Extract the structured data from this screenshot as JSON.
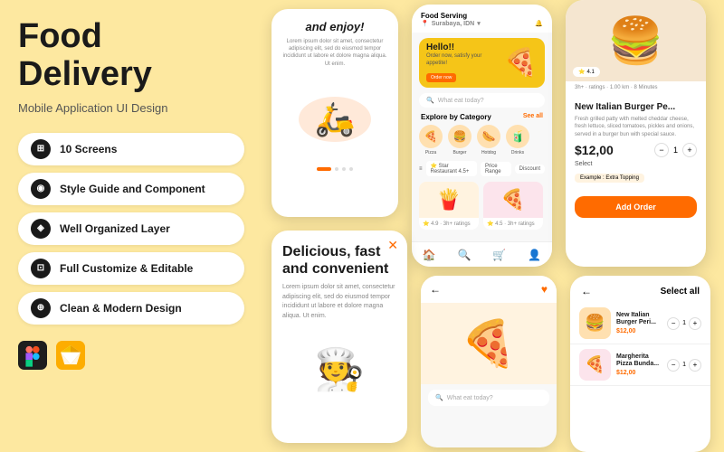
{
  "left": {
    "title": "Food Delivery",
    "subtitle": "Mobile Application UI Design",
    "features": [
      {
        "icon": "⊞",
        "label": "10 Screens"
      },
      {
        "icon": "◉",
        "label": "Style Guide and Component"
      },
      {
        "icon": "◈",
        "label": "Well Organized Layer"
      },
      {
        "icon": "⊡",
        "label": "Full Customize & Editable"
      },
      {
        "icon": "⊕",
        "label": "Clean & Modern Design"
      }
    ]
  },
  "phone1": {
    "headline": "and enjoy!",
    "body": "Lorem ipsum dolor sit amet, consectetur adipiscing elit, sed do eiusmod tempor incididunt ut labore et dolore magna aliqua. Ut enim."
  },
  "phone2": {
    "app_title": "Food Serving",
    "location": "Surabaya, IDN",
    "banner_hello": "Hello!!",
    "banner_sub": "Order now, satisfy your appetite!",
    "banner_btn": "Order now",
    "search_placeholder": "What eat today?",
    "category_title": "Explore by Category",
    "see_all": "See all",
    "categories": [
      {
        "emoji": "🍕",
        "label": "Pizza"
      },
      {
        "emoji": "🍔",
        "label": "Burger"
      },
      {
        "emoji": "🌭",
        "label": "Hotdog"
      },
      {
        "emoji": "🧃",
        "label": "Drinks"
      }
    ],
    "filters": [
      "⭐ Star Restaurant 4.5+",
      "Price Range",
      "Discount"
    ]
  },
  "phone3": {
    "rating": "4.1",
    "rating_count": "3h+ · ratings · 1.00 km · 8 Minutes",
    "name": "New Italian Burger Pe...",
    "desc": "Fresh grilled patty with melted cheddar cheese, fresh lettuce, sliced tomatoes, pickles and onions, served in a burger bun with special sauce.",
    "price": "$12,00",
    "qty": "1",
    "label": "Select",
    "extra_label": "Example : Extra Topping",
    "add_btn": "Add Order"
  },
  "phone4": {
    "headline": "Delicious, fast and convenient",
    "body": "Lorem ipsum dolor sit amet, consectetur adipiscing elit, sed do eiusmod tempor incididunt ut labore et dolore magna aliqua. Ut enim."
  },
  "phone5": {
    "search_placeholder": "What eat today?"
  },
  "phone6": {
    "title": "Select all",
    "items": [
      {
        "name": "New Italian Burger Peri...",
        "price": "$12,00",
        "qty": "1"
      },
      {
        "name": "Margherita Pizza Bunda...",
        "price": "$12,00",
        "qty": "1"
      }
    ]
  }
}
